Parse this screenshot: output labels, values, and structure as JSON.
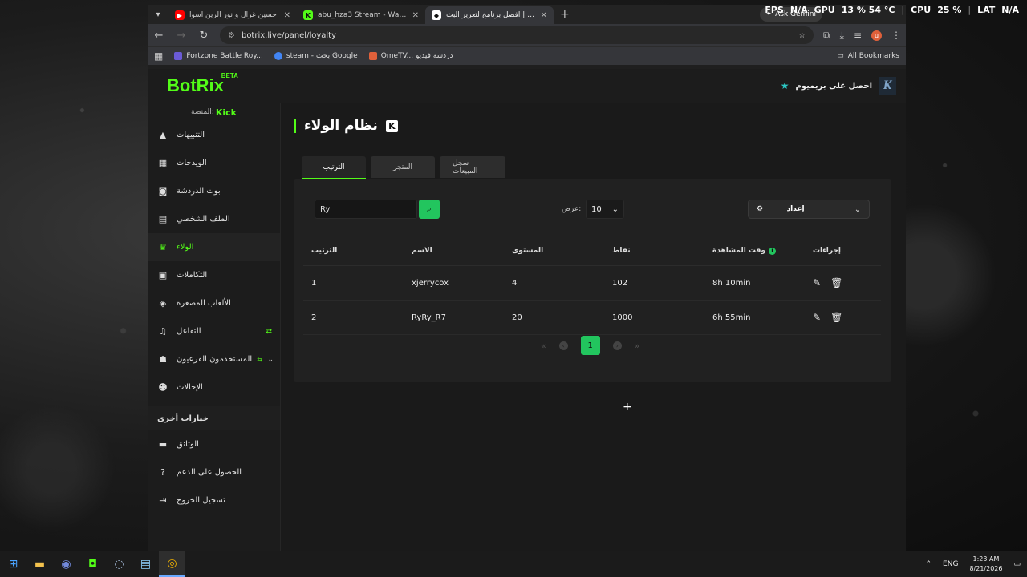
{
  "system": {
    "fps_label": "FPS",
    "fps_value": "N/A",
    "gpu_label": "GPU",
    "gpu_value": "13 % 54 °C",
    "cpu_label": "CPU",
    "cpu_value": "25 %",
    "lat_label": "LAT",
    "lat_value": "N/A"
  },
  "browser": {
    "tabs": [
      {
        "title": "حسين غزال و نور الزين اسوأ",
        "favicon_color": "#ff0000"
      },
      {
        "title": "abu_hza3 Stream - Watch Live",
        "favicon_color": "#53fc18"
      },
      {
        "title": "الولاء | أفضل برنامج لتعزيز البث",
        "favicon_color": "#ffffff",
        "active": true
      }
    ],
    "ask_gemini": "Ask Gemini",
    "url": "botrix.live/panel/loyalty",
    "profile_initial": "u",
    "bookmarks": [
      {
        "label": "Fortzone Battle Roy...",
        "color": "#6b5bd6"
      },
      {
        "label": "steam - بحث Google",
        "color": "#4285f4"
      },
      {
        "label": "OmeTV... دردشة فيديو",
        "color": "#e0603a"
      }
    ],
    "all_bookmarks": "All Bookmarks"
  },
  "header": {
    "logo": "BotRix",
    "logo_badge": "BETA",
    "premium_label": "احصل على بريميوم",
    "avatar_letter": "K"
  },
  "sidebar": {
    "platform_label": "المنصة:",
    "platform_value": "Kick",
    "items": [
      {
        "label": "التنبيهات",
        "icon": "warning-icon"
      },
      {
        "label": "الويدجات",
        "icon": "widgets-icon"
      },
      {
        "label": "بوت الدردشة",
        "icon": "robot-icon"
      },
      {
        "label": "الملف الشخصي",
        "icon": "id-card-icon"
      },
      {
        "label": "الولاء",
        "icon": "trophy-icon",
        "active": true
      },
      {
        "label": "التكاملات",
        "icon": "integration-icon"
      },
      {
        "label": "الألعاب المصغرة",
        "icon": "gamepad-icon"
      },
      {
        "label": "التفاعل",
        "icon": "music-icon",
        "extra": "new"
      },
      {
        "label": "المستخدمون الفرعيون",
        "icon": "users-icon"
      },
      {
        "label": "الإحالات",
        "icon": "referrals-icon"
      }
    ],
    "other_title": "خيارات أخرى",
    "other_items": [
      {
        "label": "الوثائق",
        "icon": "docs-icon"
      },
      {
        "label": "الحصول على الدعم",
        "icon": "help-icon"
      },
      {
        "label": "تسجيل الخروج",
        "icon": "logout-icon"
      }
    ]
  },
  "main": {
    "title": "نظام الولاء",
    "tabs": [
      {
        "label": "الترتيب",
        "active": true
      },
      {
        "label": "المتجر"
      },
      {
        "label": "سجل المبيعات"
      }
    ],
    "search_value": "Ry",
    "show_label": "عرض:",
    "show_value": "10",
    "setup_label": "إعداد",
    "table": {
      "headers": [
        "الترتيب",
        "الاسم",
        "المستوى",
        "نقاط",
        "وقت المشاهدة",
        "إجراءات"
      ],
      "rows": [
        {
          "rank": "1",
          "name": "xjerrycox",
          "level": "4",
          "points": "102",
          "watch": "8h 10min"
        },
        {
          "rank": "2",
          "name": "RyRy_R7",
          "level": "20",
          "points": "1000",
          "watch": "6h 55min"
        }
      ]
    },
    "pagination": {
      "current": "1"
    }
  },
  "taskbar": {
    "lang": "ENG",
    "time": "1:23 AM",
    "date": "8/21/2026"
  }
}
